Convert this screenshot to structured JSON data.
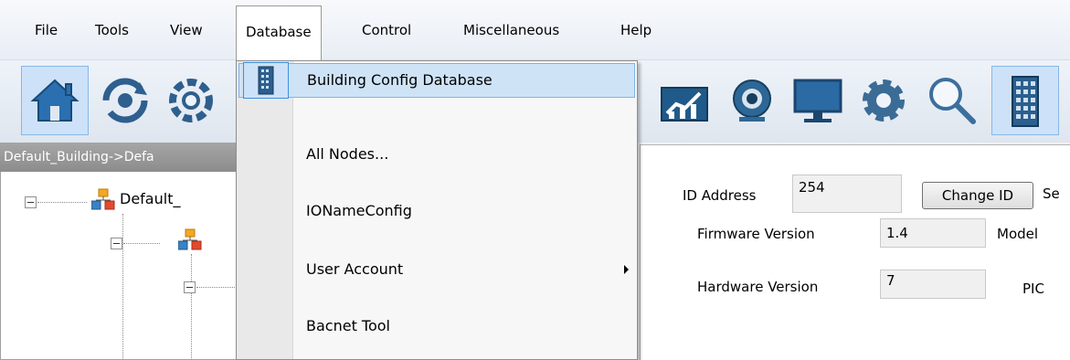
{
  "menubar": {
    "items": [
      {
        "label": "File"
      },
      {
        "label": "Tools"
      },
      {
        "label": "View"
      },
      {
        "label": "Database"
      },
      {
        "label": "Control"
      },
      {
        "label": "Miscellaneous"
      },
      {
        "label": "Help"
      }
    ]
  },
  "toolbar": {
    "icons": [
      "home-icon",
      "sync-icon",
      "refresh-gear-icon",
      "chart-icon",
      "webcam-icon",
      "monitor-icon",
      "settings-gear-icon",
      "search-icon",
      "building-icon"
    ]
  },
  "breadcrumb": {
    "text": "Default_Building->Defa"
  },
  "tree": {
    "root_label": "Default_"
  },
  "database_menu": {
    "items": [
      {
        "label": "Building Config Database",
        "icon": "building-icon",
        "highlighted": true
      },
      {
        "label": "All Nodes..."
      },
      {
        "label": "IONameConfig"
      },
      {
        "label": "User Account",
        "submenu": true
      },
      {
        "label": "Bacnet Tool"
      }
    ]
  },
  "device_panel": {
    "id_address_label": "ID Address",
    "id_address_value": "254",
    "change_id_label": "Change ID",
    "se_label": "Se",
    "firmware_label": "Firmware Version",
    "firmware_value": "1.4",
    "model_label": "Model",
    "hardware_label": "Hardware Version",
    "hardware_value": "7",
    "pic_label": "PIC"
  },
  "colors": {
    "menu_highlight": "#cfe3f6",
    "menu_highlight_border": "#7eb4ea",
    "toolbar_selected": "#cde2f8"
  }
}
